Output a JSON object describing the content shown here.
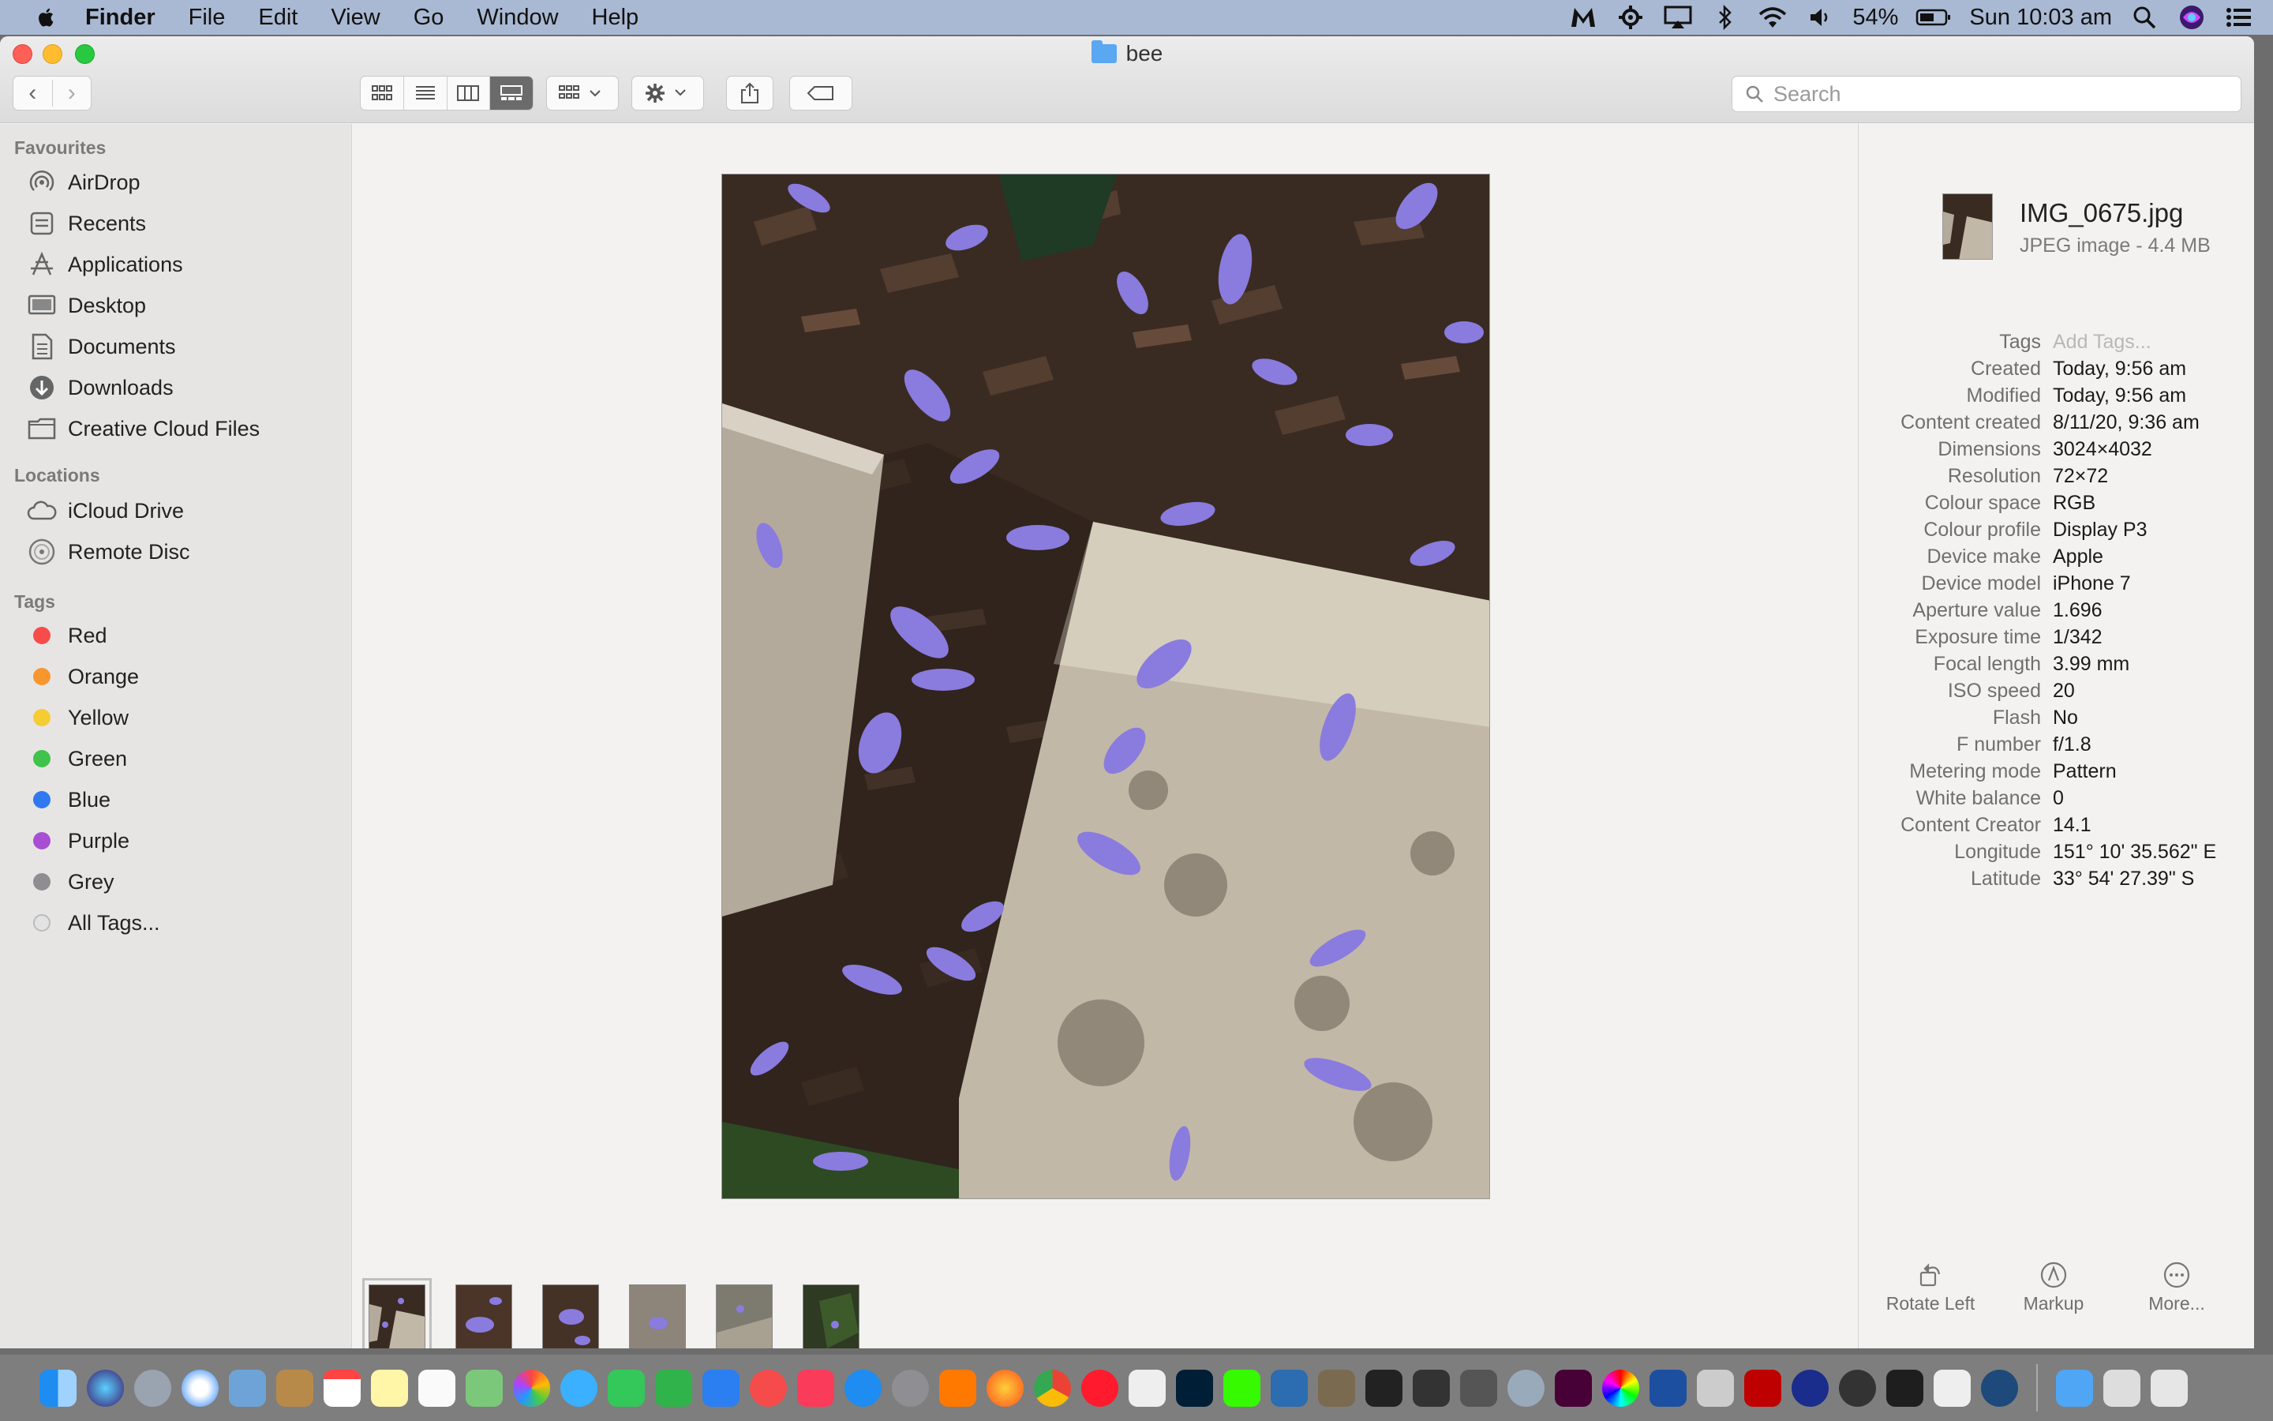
{
  "menubar": {
    "app": "Finder",
    "items": [
      "File",
      "Edit",
      "View",
      "Go",
      "Window",
      "Help"
    ],
    "battery": "54%",
    "clock": "Sun 10:03 am"
  },
  "window": {
    "title": "bee",
    "search_placeholder": "Search"
  },
  "sidebar": {
    "favourites_header": "Favourites",
    "favourites": [
      "AirDrop",
      "Recents",
      "Applications",
      "Desktop",
      "Documents",
      "Downloads",
      "Creative Cloud Files"
    ],
    "locations_header": "Locations",
    "locations": [
      "iCloud Drive",
      "Remote Disc"
    ],
    "tags_header": "Tags",
    "tags": [
      {
        "label": "Red",
        "color": "#f64d4a"
      },
      {
        "label": "Orange",
        "color": "#f7962d"
      },
      {
        "label": "Yellow",
        "color": "#f6cc33"
      },
      {
        "label": "Green",
        "color": "#3fc34b"
      },
      {
        "label": "Blue",
        "color": "#2f78f0"
      },
      {
        "label": "Purple",
        "color": "#a84ed3"
      },
      {
        "label": "Grey",
        "color": "#8e8e92"
      },
      {
        "label": "All Tags...",
        "color": "#d0d0d0"
      }
    ]
  },
  "inspector": {
    "file_name": "IMG_0675.jpg",
    "file_kind": "JPEG image - 4.4 MB",
    "metadata": [
      {
        "key": "Tags",
        "value": "Add Tags..."
      },
      {
        "key": "Created",
        "value": "Today, 9:56 am"
      },
      {
        "key": "Modified",
        "value": "Today, 9:56 am"
      },
      {
        "key": "Content created",
        "value": "8/11/20, 9:36 am"
      },
      {
        "key": "Dimensions",
        "value": "3024×4032"
      },
      {
        "key": "Resolution",
        "value": "72×72"
      },
      {
        "key": "Colour space",
        "value": "RGB"
      },
      {
        "key": "Colour profile",
        "value": "Display P3"
      },
      {
        "key": "Device make",
        "value": "Apple"
      },
      {
        "key": "Device model",
        "value": "iPhone 7"
      },
      {
        "key": "Aperture value",
        "value": "1.696"
      },
      {
        "key": "Exposure time",
        "value": "1/342"
      },
      {
        "key": "Focal length",
        "value": "3.99 mm"
      },
      {
        "key": "ISO speed",
        "value": "20"
      },
      {
        "key": "Flash",
        "value": "No"
      },
      {
        "key": "F number",
        "value": "f/1.8"
      },
      {
        "key": "Metering mode",
        "value": "Pattern"
      },
      {
        "key": "White balance",
        "value": "0"
      },
      {
        "key": "Content Creator",
        "value": "14.1"
      },
      {
        "key": "Longitude",
        "value": "151° 10' 35.562\" E"
      },
      {
        "key": "Latitude",
        "value": "33° 54' 27.39\" S"
      }
    ],
    "actions": [
      "Rotate Left",
      "Markup",
      "More..."
    ]
  },
  "gallery": {
    "selected_index": 0,
    "thumbnail_count": 6
  }
}
